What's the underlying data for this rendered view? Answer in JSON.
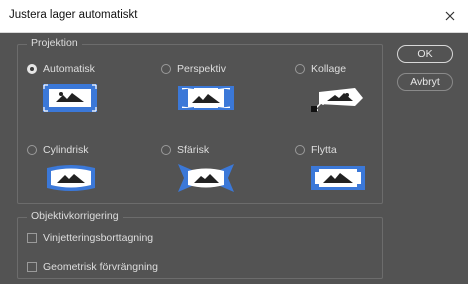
{
  "window": {
    "title": "Justera lager automatiskt"
  },
  "projection": {
    "legend": "Projektion",
    "selected": "Automatisk",
    "options": [
      {
        "label": "Automatisk",
        "icon": "auto-layout-icon"
      },
      {
        "label": "Perspektiv",
        "icon": "perspective-layout-icon"
      },
      {
        "label": "Kollage",
        "icon": "collage-layout-icon"
      },
      {
        "label": "Cylindrisk",
        "icon": "cylindrical-layout-icon"
      },
      {
        "label": "Sfärisk",
        "icon": "spherical-layout-icon"
      },
      {
        "label": "Flytta",
        "icon": "reposition-layout-icon"
      }
    ]
  },
  "lens": {
    "legend": "Objektivkorrigering",
    "options": [
      {
        "label": "Vinjetteringsborttagning",
        "checked": false
      },
      {
        "label": "Geometrisk förvrängning",
        "checked": false
      }
    ]
  },
  "buttons": {
    "ok": "OK",
    "cancel": "Avbryt"
  },
  "colors": {
    "accent": "#3b78d8",
    "panel": "#535353"
  }
}
